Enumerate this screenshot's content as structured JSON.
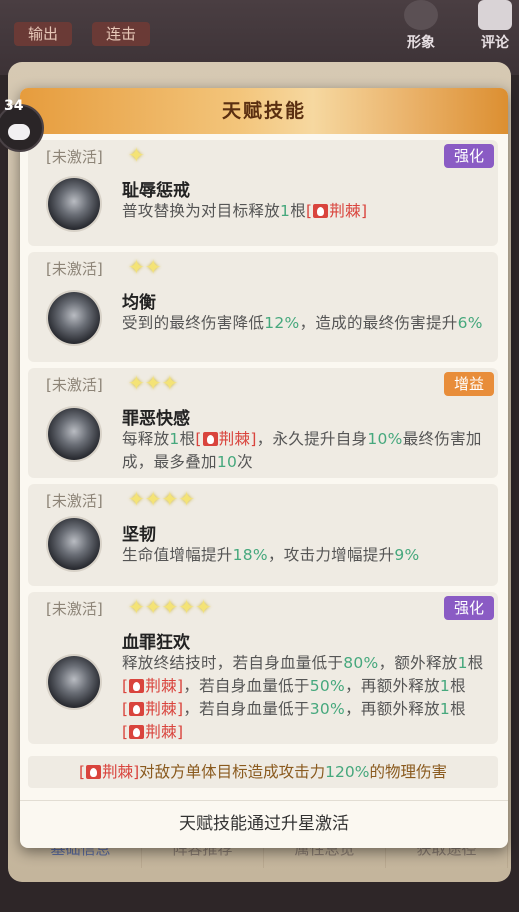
{
  "top_bar": {
    "tab_output": "输出",
    "tab_combo": "连击",
    "appearance": "形象",
    "comment": "评论"
  },
  "bottom_tabs": [
    "基础信息",
    "阵容推荐",
    "属性总览",
    "获取途径"
  ],
  "modal": {
    "title": "天赋技能",
    "level": "34",
    "skills": [
      {
        "status": "[未激活]",
        "stars": 1,
        "tag": "强化",
        "tag_color": "#8a5bc4",
        "name": "耻辱惩戒",
        "desc": [
          {
            "t": "普攻替换为对目标释放"
          },
          {
            "n": "1"
          },
          {
            "t": "根"
          },
          {
            "r": "荆棘"
          }
        ]
      },
      {
        "status": "[未激活]",
        "stars": 2,
        "tag": "",
        "name": "均衡",
        "desc": [
          {
            "t": "受到的最终伤害降低"
          },
          {
            "n": "12%"
          },
          {
            "t": "，造成的最终伤害提升"
          },
          {
            "n": "6%"
          }
        ]
      },
      {
        "status": "[未激活]",
        "stars": 3,
        "tag": "增益",
        "tag_color": "#e88d3a",
        "name": "罪恶快感",
        "desc": [
          {
            "t": "每释放"
          },
          {
            "n": "1"
          },
          {
            "t": "根"
          },
          {
            "r": "荆棘"
          },
          {
            "t": "，永久提升自身"
          },
          {
            "n": "10%"
          },
          {
            "t": "最终伤害加成，最多叠加"
          },
          {
            "n": "10"
          },
          {
            "t": "次"
          }
        ]
      },
      {
        "status": "[未激活]",
        "stars": 4,
        "tag": "",
        "name": "坚韧",
        "desc": [
          {
            "t": "生命值增幅提升"
          },
          {
            "n": "18%"
          },
          {
            "t": "，攻击力增幅提升"
          },
          {
            "n": "9%"
          }
        ]
      },
      {
        "status": "[未激活]",
        "stars": 5,
        "tag": "强化",
        "tag_color": "#8a5bc4",
        "name": "血罪狂欢",
        "desc": [
          {
            "t": "释放终结技时，若自身血量低于"
          },
          {
            "n": "80%"
          },
          {
            "t": "，额外释放"
          },
          {
            "n": "1"
          },
          {
            "t": "根"
          },
          {
            "r": "荆棘"
          },
          {
            "t": "，若自身血量低于"
          },
          {
            "n": "50%"
          },
          {
            "t": "，再额外释放"
          },
          {
            "n": "1"
          },
          {
            "t": "根"
          },
          {
            "r": "荆棘"
          },
          {
            "t": "，若自身血量低于"
          },
          {
            "n": "30%"
          },
          {
            "t": "，再额外释放"
          },
          {
            "n": "1"
          },
          {
            "t": "根"
          },
          {
            "r": "荆棘"
          }
        ]
      }
    ],
    "footnote": {
      "ref": "荆棘",
      "text_before": "对敌方单体目标造成攻击力",
      "value": "120%",
      "text_after": "的物理伤害"
    },
    "footer": "天赋技能通过升星激活"
  }
}
